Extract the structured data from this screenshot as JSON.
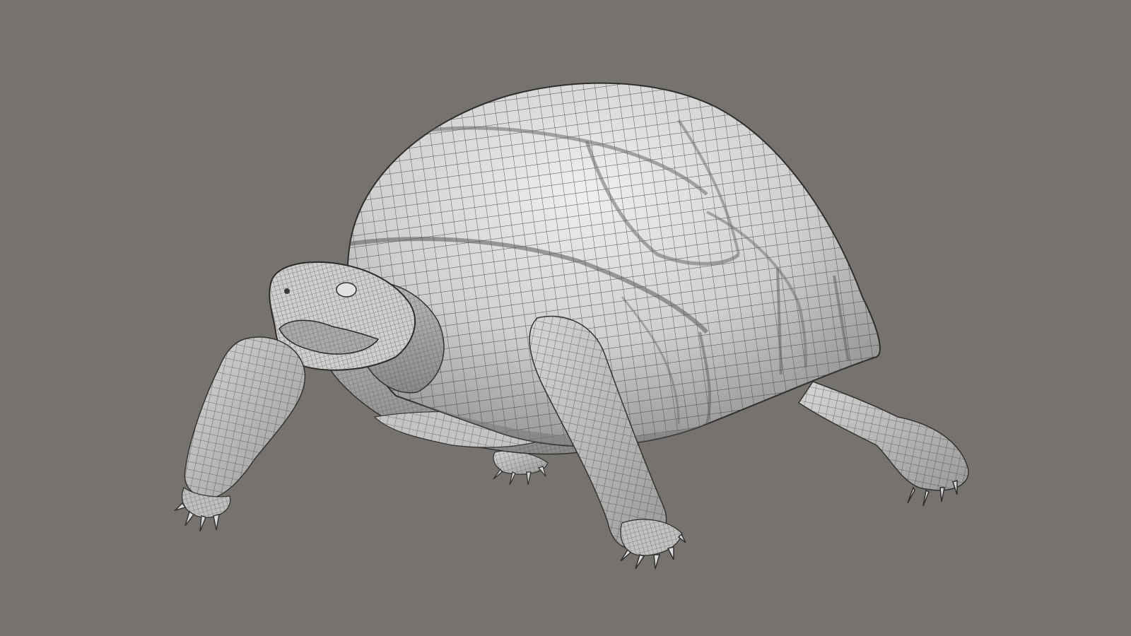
{
  "scene": {
    "subject": "tortoise-wireframe-model",
    "colors": {
      "background": "#76736e",
      "surface_light": "#d9d9d9",
      "surface_mid": "#b8b8b8",
      "surface_dark": "#8c8c8c",
      "wire": "#3c3c3c"
    }
  }
}
